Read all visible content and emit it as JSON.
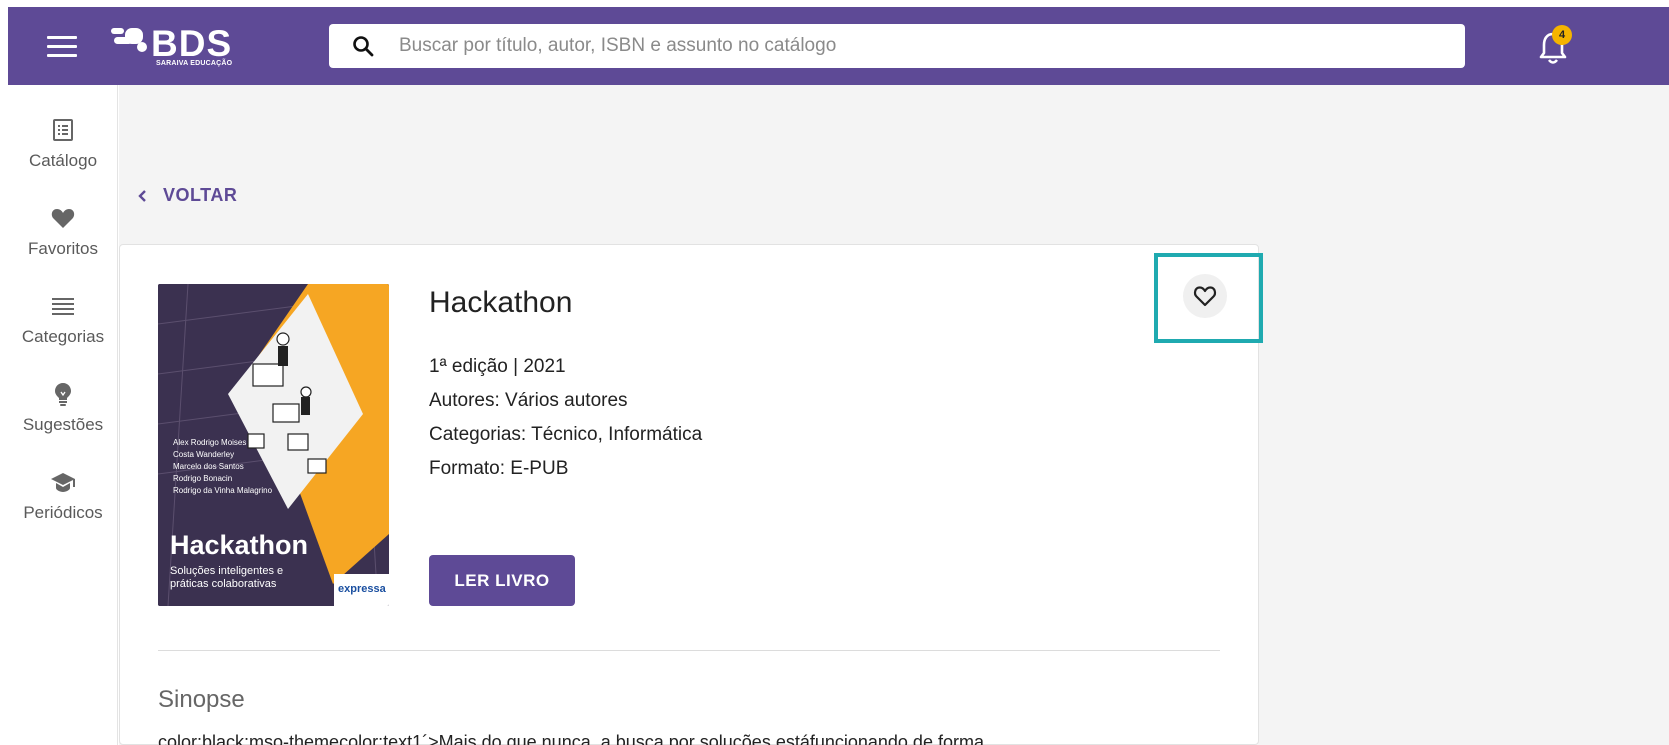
{
  "header": {
    "menu_icon": "hamburger-icon",
    "logo": {
      "name": "BDS",
      "subtitle": "SARAIVA EDUCAÇÃO"
    },
    "search": {
      "placeholder": "Buscar por título, autor, ISBN e assunto no catálogo",
      "icon": "search-icon"
    },
    "notifications": {
      "icon": "bell-icon",
      "count": "4"
    }
  },
  "sidebar": {
    "items": [
      {
        "label": "Catálogo",
        "icon": "catalog-icon"
      },
      {
        "label": "Favoritos",
        "icon": "heart-icon"
      },
      {
        "label": "Categorias",
        "icon": "list-icon"
      },
      {
        "label": "Sugestões",
        "icon": "lightbulb-icon"
      },
      {
        "label": "Periódicos",
        "icon": "graduation-cap-icon"
      }
    ]
  },
  "back": {
    "label": "VOLTAR",
    "icon": "chevron-left-icon"
  },
  "book": {
    "title": "Hackathon",
    "edition": "1ª edição | 2021",
    "authors": "Autores: Vários autores",
    "categories": "Categorias: Técnico, Informática",
    "format": "Formato: E-PUB",
    "read_button": "LER LIVRO",
    "favorite_icon": "heart-outline-icon",
    "cover": {
      "authors": [
        "Alex Rodrigo Moises",
        "Costa Wanderley",
        "Marcelo dos Santos",
        "Rodrigo Bonacin",
        "Rodrigo da Vinha Malagrino"
      ],
      "title": "Hackathon",
      "subtitle_line1": "Soluções inteligentes e",
      "subtitle_line2": "práticas colaborativas",
      "publisher": "expressa"
    }
  },
  "synopsis": {
    "heading": "Sinopse",
    "text": "color:black;mso-themecolor:text1´>Mais do que nunca, a busca por soluções estáfuncionando de forma"
  },
  "colors": {
    "brand_purple": "#5e4a96",
    "highlight_teal": "#1faab0",
    "cover_yellow": "#f6a623",
    "badge_yellow": "#f5b400"
  }
}
